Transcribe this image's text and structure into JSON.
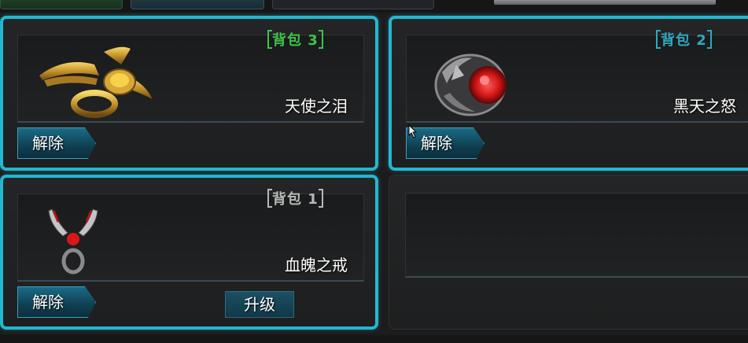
{
  "colors": {
    "selected_border": "#22b8d0",
    "bag3_label": "#3fc24c",
    "bag2_label": "#2ea8c0",
    "bag1_label": "#b8b8b8"
  },
  "slots": [
    {
      "bag_label": "背包 3",
      "item_name": "天使之泪",
      "remove_label": "解除",
      "icon": "angel-wing-ring-icon"
    },
    {
      "bag_label": "背包 2",
      "item_name": "黑天之怒",
      "remove_label": "解除",
      "icon": "dark-red-gem-ring-icon"
    },
    {
      "bag_label": "背包 1",
      "item_name": "血魄之戒",
      "remove_label": "解除",
      "upgrade_label": "升级",
      "icon": "blood-scythe-ring-icon"
    }
  ]
}
